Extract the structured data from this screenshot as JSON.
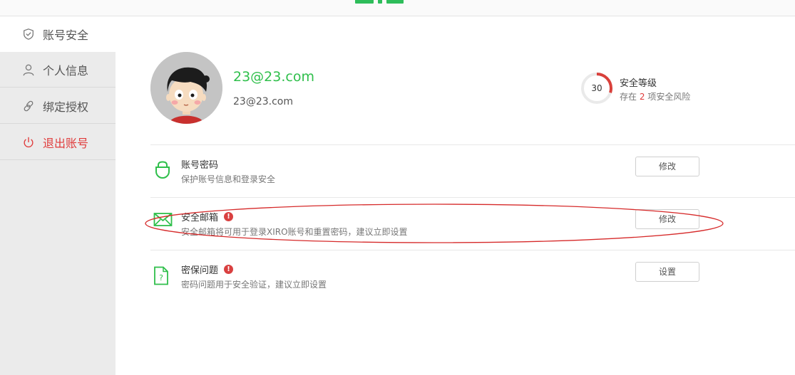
{
  "sidebar": {
    "items": [
      {
        "label": "账号安全",
        "icon": "shield-icon"
      },
      {
        "label": "个人信息",
        "icon": "person-icon"
      },
      {
        "label": "绑定授权",
        "icon": "link-icon"
      },
      {
        "label": "退出账号",
        "icon": "power-icon"
      }
    ]
  },
  "profile": {
    "email_main": "23@23.com",
    "email_sub": "23@23.com"
  },
  "security": {
    "score": "30",
    "score_fraction": 0.3,
    "title": "安全等级",
    "desc_prefix": "存在",
    "risk_count": "2",
    "desc_suffix": "项安全风险"
  },
  "rows": [
    {
      "title": "账号密码",
      "desc": "保护账号信息和登录安全",
      "button": "修改",
      "icon": "shield-bag-icon",
      "warning": ""
    },
    {
      "title": "安全邮箱",
      "desc": "安全邮箱将可用于登录XIRO账号和重置密码，建议立即设置",
      "button": "修改",
      "icon": "mail-icon",
      "warning": "!"
    },
    {
      "title": "密保问题",
      "desc": "密码问题用于安全验证，建议立即设置",
      "button": "设置",
      "icon": "question-doc-icon",
      "warning": "!"
    }
  ],
  "colors": {
    "accent": "#2fbf4b",
    "danger": "#e03b3b",
    "sidebar_bg": "#ebebeb"
  }
}
